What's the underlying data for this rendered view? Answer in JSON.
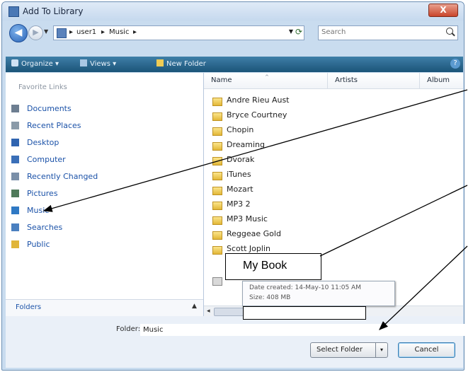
{
  "window": {
    "title": "Add To Library",
    "close_label": "X"
  },
  "address_bar": {
    "back_glyph": "◀",
    "forward_glyph": "▶",
    "crumbs": [
      "user1",
      "Music"
    ],
    "crumb_sep": "▸",
    "search_placeholder": "Search"
  },
  "toolbar": {
    "organize": "Organize ▾",
    "views": "Views ▾",
    "new_folder": "New Folder",
    "help": "?"
  },
  "nav_pane": {
    "heading": "Favorite Links",
    "items": [
      {
        "label": "Documents",
        "icon": "documents-icon",
        "color": "#6d7e91"
      },
      {
        "label": "Recent Places",
        "icon": "recent-places-icon",
        "color": "#8a9aa8"
      },
      {
        "label": "Desktop",
        "icon": "desktop-icon",
        "color": "#2f64b0"
      },
      {
        "label": "Computer",
        "icon": "computer-icon",
        "color": "#3a6fb8"
      },
      {
        "label": "Recently Changed",
        "icon": "recently-changed-icon",
        "color": "#7a8fa8"
      },
      {
        "label": "Pictures",
        "icon": "pictures-icon",
        "color": "#4f7a5a"
      },
      {
        "label": "Music",
        "icon": "music-icon",
        "color": "#2f79c4"
      },
      {
        "label": "Searches",
        "icon": "searches-icon",
        "color": "#4a80c0"
      },
      {
        "label": "Public",
        "icon": "public-icon",
        "color": "#e0b53a"
      }
    ],
    "folders_label": "Folders",
    "folders_chevron": "▲"
  },
  "file_list": {
    "columns": [
      "Name",
      "Artists",
      "Album"
    ],
    "sort_indicator": "^",
    "rows": [
      "Andre Rieu Aust",
      "Bryce Courtney",
      "Chopin",
      "Dreaming",
      "Dvorak",
      "iTunes",
      "Mozart",
      "MP3 2",
      "MP3 Music",
      "Reggeae Gold",
      "Scott Joplin"
    ],
    "scroll_left_glyph": "◂"
  },
  "tooltip": {
    "date_created": "Date created: 14-May-10 11:05 AM",
    "size": "Size: 408 MB"
  },
  "callout": {
    "label": "My Book"
  },
  "bottom": {
    "folder_label": "Folder:",
    "folder_value": "Music",
    "select_folder": "Select Folder",
    "select_dd": "▾",
    "cancel": "Cancel"
  }
}
